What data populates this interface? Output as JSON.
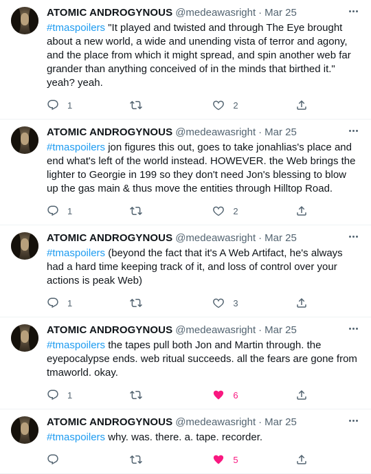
{
  "tweets": [
    {
      "name": "ATOMIC ANDROGYNOUS",
      "handle": "@medeawasright",
      "sep": "·",
      "date": "Mar 25",
      "hashtag": "#tmaspoilers",
      "body": " \"It played and twisted and through The Eye brought about a new world, a wide and unending vista of terror and agony, and the place from which it might spread, and spin another web far grander than anything conceived of in the minds that birthed it.\" yeah? yeah.",
      "replies": "1",
      "retweets": "",
      "likes": "2",
      "liked": false
    },
    {
      "name": "ATOMIC ANDROGYNOUS",
      "handle": "@medeawasright",
      "sep": "·",
      "date": "Mar 25",
      "hashtag": "#tmaspoilers",
      "body": " jon figures this out, goes to take jonahlias's place and end what's left of the world instead. HOWEVER. the Web brings the lighter to Georgie in 199 so they don't need Jon's blessing to blow up the gas main & thus move the entities through Hilltop Road.",
      "replies": "1",
      "retweets": "",
      "likes": "2",
      "liked": false
    },
    {
      "name": "ATOMIC ANDROGYNOUS",
      "handle": "@medeawasright",
      "sep": "·",
      "date": "Mar 25",
      "hashtag": "#tmaspoilers",
      "body": " (beyond the fact that it's A Web Artifact, he's always had a hard time keeping track of it, and loss of control over your actions is peak Web)",
      "replies": "1",
      "retweets": "",
      "likes": "3",
      "liked": false
    },
    {
      "name": "ATOMIC ANDROGYNOUS",
      "handle": "@medeawasright",
      "sep": "·",
      "date": "Mar 25",
      "hashtag": "#tmaspoilers",
      "body": " the tapes pull both Jon and Martin through. the eyepocalypse ends. web ritual succeeds. all the fears are gone from tmaworld. okay.",
      "replies": "1",
      "retweets": "",
      "likes": "6",
      "liked": true
    },
    {
      "name": "ATOMIC ANDROGYNOUS",
      "handle": "@medeawasright",
      "sep": "·",
      "date": "Mar 25",
      "hashtag": "#tmaspoilers",
      "body": " why. was. there. a. tape. recorder.",
      "replies": "",
      "retweets": "",
      "likes": "5",
      "liked": true
    }
  ],
  "icons": {
    "reply": "reply-icon",
    "retweet": "retweet-icon",
    "like": "heart-icon",
    "share": "share-icon",
    "more": "more-icon"
  },
  "colors": {
    "link": "#1d9bf0",
    "like_active": "#f91880",
    "muted": "#536471",
    "divider": "#eff3f4"
  }
}
